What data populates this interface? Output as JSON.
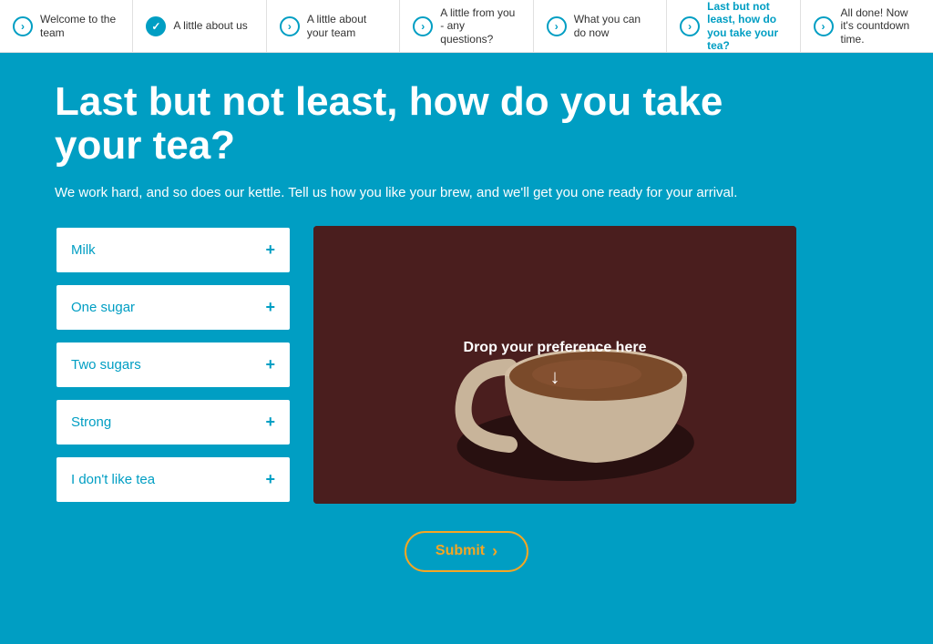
{
  "nav": {
    "items": [
      {
        "id": "welcome",
        "label": "Welcome to the team",
        "status": "active",
        "icon": "chevron"
      },
      {
        "id": "about-us",
        "label": "A little about us",
        "status": "checked",
        "icon": "check"
      },
      {
        "id": "about-team",
        "label": "A little about your team",
        "status": "chevron",
        "icon": "chevron"
      },
      {
        "id": "from-you",
        "label": "A little from you - any questions?",
        "status": "chevron",
        "icon": "chevron"
      },
      {
        "id": "what-you-can-do",
        "label": "What you can do now",
        "status": "chevron",
        "icon": "chevron"
      },
      {
        "id": "tea",
        "label": "Last but not least, how do you take your tea?",
        "status": "chevron-active",
        "icon": "chevron"
      },
      {
        "id": "all-done",
        "label": "All done! Now it's countdown time.",
        "status": "chevron",
        "icon": "chevron"
      }
    ]
  },
  "page": {
    "title": "Last but not least, how do you take your tea?",
    "subtitle": "We work hard, and so does our kettle. Tell us how you like your brew, and we'll get you one ready for your arrival.",
    "options": [
      {
        "id": "milk",
        "label": "Milk"
      },
      {
        "id": "one-sugar",
        "label": "One sugar"
      },
      {
        "id": "two-sugars",
        "label": "Two sugars"
      },
      {
        "id": "strong",
        "label": "Strong"
      },
      {
        "id": "no-tea",
        "label": "I don't like tea"
      }
    ],
    "drop_zone": {
      "text": "Drop your preference here",
      "arrow": "↓"
    },
    "submit_label": "Submit",
    "submit_arrow": "›"
  }
}
